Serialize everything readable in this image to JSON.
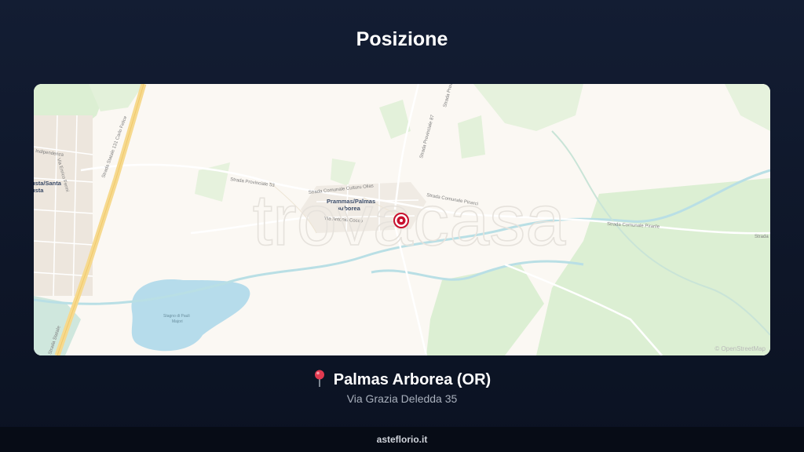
{
  "section": {
    "title": "Posizione"
  },
  "map": {
    "watermark": "trovacasa",
    "attribution": "© OpenStreetMap",
    "labels": {
      "town": "Prammas/Palmas Arborea",
      "town_line1": "Prammas/Palmas",
      "town_line2": "Arborea",
      "road_sp53": "Strada Provinciale 53",
      "road_comunale_cuttury": "Strada Comunale Cutturu Olias",
      "road_comunale_pinarci": "Strada Comunale Pinarci",
      "road_comunale_pirarile": "Strada Comunale Pirarile",
      "road_sp87": "Strada Provinciale 87",
      "road_sp": "Strada Provinciale",
      "road_ss131": "Strada Statale 131 Carlo Felice",
      "road_statale": "Strada Statale",
      "street_indipendenza": "Indipendenza",
      "street_antonio": "Via Antonio Cocco",
      "street_enrico": "Via Enrico Fermi",
      "left_town_line1": "usta/Santa",
      "left_town_line2": "usta",
      "lake_line1": "Stagno di Pauli",
      "lake_line2": "Majori",
      "right_road": "Strada"
    },
    "colors": {
      "background": "#fbf8f3",
      "green": "#d9ecd0",
      "road": "#ffffff",
      "highway": "#f6d98e",
      "water": "#b6dceb",
      "pin": "#c8102e"
    }
  },
  "location": {
    "pin_icon": "round-pushpin-icon",
    "name": "Palmas Arborea (OR)",
    "address": "Via Grazia Deledda 35"
  },
  "footer": {
    "site": "asteflorio.it"
  }
}
